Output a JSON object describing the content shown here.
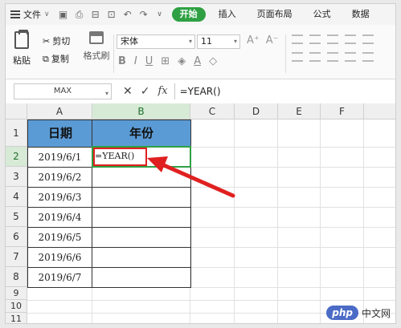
{
  "menu": {
    "file_label": "文件",
    "tabs": [
      "开始",
      "插入",
      "页面布局",
      "公式",
      "数据"
    ],
    "active_tab": 0
  },
  "ribbon": {
    "paste_label": "粘贴",
    "cut_label": "剪切",
    "copy_label": "复制",
    "format_painter_label": "格式刷",
    "font_name": "宋体",
    "font_size": "11",
    "bold": "B",
    "italic": "I",
    "underline": "U"
  },
  "formula_bar": {
    "name_box": "MAX",
    "formula": "=YEAR()",
    "cancel": "✕",
    "confirm": "✓",
    "fx": "fx"
  },
  "sheet": {
    "columns": [
      "A",
      "B",
      "C",
      "D",
      "E",
      "F"
    ],
    "rows": [
      "1",
      "2",
      "3",
      "4",
      "5",
      "6",
      "7",
      "8",
      "9",
      "10",
      "11"
    ],
    "header_a": "日期",
    "header_b": "年份",
    "dates": [
      "2019/6/1",
      "2019/6/2",
      "2019/6/3",
      "2019/6/4",
      "2019/6/5",
      "2019/6/6",
      "2019/6/7"
    ],
    "editing_text": "=YEAR()"
  },
  "watermark": {
    "badge": "php",
    "text": "中文网"
  },
  "colors": {
    "accent": "#2ea043",
    "header_fill": "#5b9bd5",
    "arrow": "#e02020"
  }
}
